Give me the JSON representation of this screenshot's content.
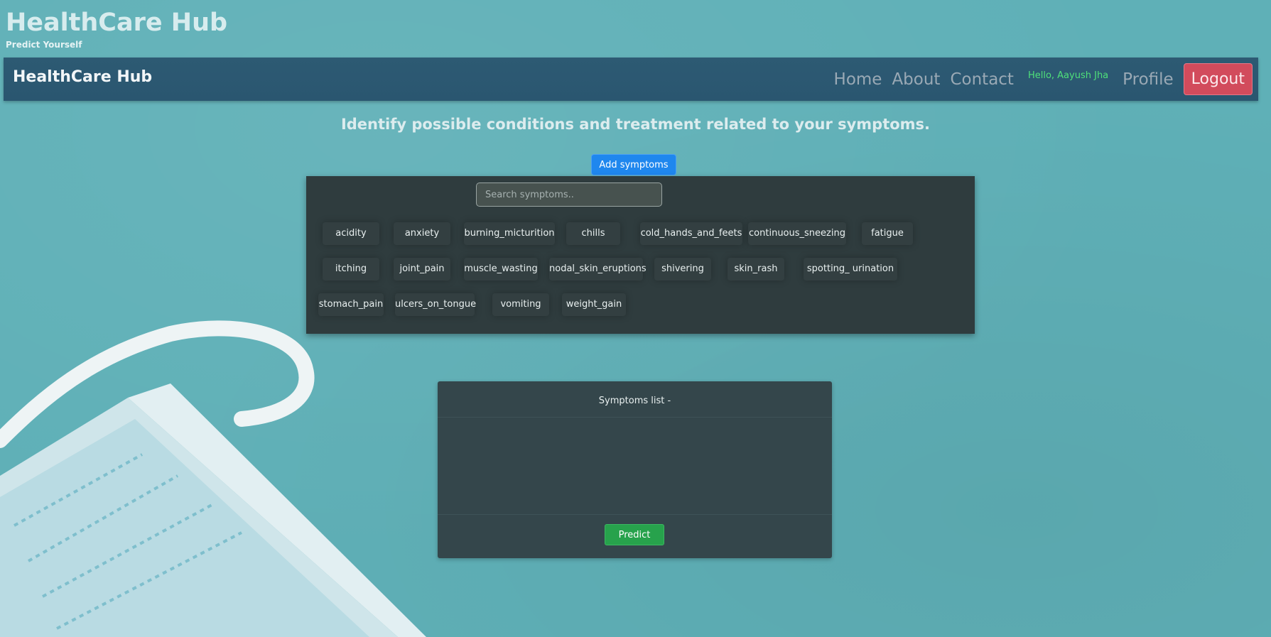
{
  "brand": {
    "title": "HealthCare Hub",
    "tagline": "Predict Yourself"
  },
  "navbar": {
    "brand": "HealthCare Hub",
    "links": [
      "Home",
      "About",
      "Contact"
    ],
    "greeting": "Hello, Aayush Jha",
    "profile": "Profile",
    "logout": "Logout"
  },
  "main": {
    "headline": "Identify possible conditions and treatment related to your symptoms.",
    "add_button": "Add symptoms",
    "search_placeholder": "Search symptoms..",
    "symptoms": [
      "acidity",
      "anxiety",
      "burning_micturition",
      "chills",
      "cold_hands_and_feets",
      "continuous_sneezing",
      "fatigue",
      "itching",
      "joint_pain",
      "muscle_wasting",
      "nodal_skin_eruptions",
      "shivering",
      "skin_rash",
      "spotting_ urination",
      "stomach_pain",
      "ulcers_on_tongue",
      "vomiting",
      "weight_gain"
    ]
  },
  "card": {
    "title": "Symptoms list -",
    "predict_button": "Predict"
  },
  "colors": {
    "navbar": "#2d5a73",
    "logout": "#d24b5c",
    "greeting": "#4fe07a",
    "add": "#1f87ee",
    "predict": "#27a24c"
  }
}
